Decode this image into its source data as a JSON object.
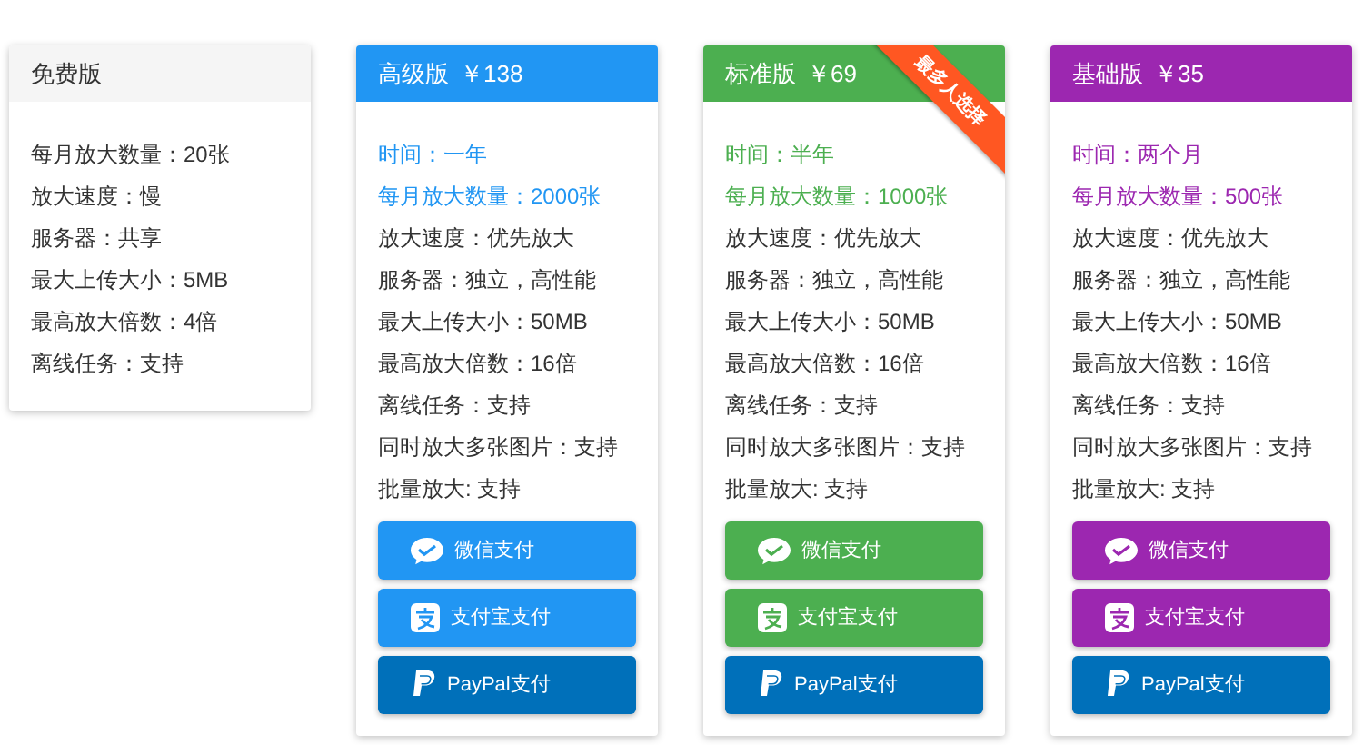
{
  "plans": [
    {
      "name": "免费版",
      "features": [
        {
          "text": "每月放大数量：20张"
        },
        {
          "text": "放大速度：慢"
        },
        {
          "text": "服务器：共享"
        },
        {
          "text": "最大上传大小：5MB"
        },
        {
          "text": "最高放大倍数：4倍"
        },
        {
          "text": "离线任务：支持"
        }
      ]
    },
    {
      "name": "高级版",
      "price": "￥138",
      "color": "#2196f3",
      "features": [
        {
          "text": "时间：一年",
          "highlight": true
        },
        {
          "text": "每月放大数量：2000张",
          "highlight": true
        },
        {
          "text": "放大速度：优先放大",
          "highlight": false
        },
        {
          "text": "服务器：独立，高性能",
          "highlight": false
        },
        {
          "text": "最大上传大小：50MB",
          "highlight": false
        },
        {
          "text": "最高放大倍数：16倍",
          "highlight": false
        },
        {
          "text": "离线任务：支持",
          "highlight": false
        },
        {
          "text": "同时放大多张图片：支持",
          "highlight": false
        },
        {
          "text": "批量放大: 支持",
          "highlight": false
        }
      ],
      "payments": [
        {
          "label": "微信支付",
          "kind": "wechat"
        },
        {
          "label": "支付宝支付",
          "kind": "alipay"
        },
        {
          "label": "PayPal支付",
          "kind": "paypal"
        }
      ]
    },
    {
      "name": "标准版",
      "price": "￥69",
      "color": "#4caf50",
      "ribbon": "最多人选择",
      "features": [
        {
          "text": "时间：半年",
          "highlight": true
        },
        {
          "text": "每月放大数量：1000张",
          "highlight": true
        },
        {
          "text": "放大速度：优先放大",
          "highlight": false
        },
        {
          "text": "服务器：独立，高性能",
          "highlight": false
        },
        {
          "text": "最大上传大小：50MB",
          "highlight": false
        },
        {
          "text": "最高放大倍数：16倍",
          "highlight": false
        },
        {
          "text": "离线任务：支持",
          "highlight": false
        },
        {
          "text": "同时放大多张图片：支持",
          "highlight": false
        },
        {
          "text": "批量放大: 支持",
          "highlight": false
        }
      ],
      "payments": [
        {
          "label": "微信支付",
          "kind": "wechat"
        },
        {
          "label": "支付宝支付",
          "kind": "alipay"
        },
        {
          "label": "PayPal支付",
          "kind": "paypal"
        }
      ]
    },
    {
      "name": "基础版",
      "price": "￥35",
      "color": "#9c27b0",
      "features": [
        {
          "text": "时间：两个月",
          "highlight": true
        },
        {
          "text": "每月放大数量：500张",
          "highlight": true
        },
        {
          "text": "放大速度：优先放大",
          "highlight": false
        },
        {
          "text": "服务器：独立，高性能",
          "highlight": false
        },
        {
          "text": "最大上传大小：50MB",
          "highlight": false
        },
        {
          "text": "最高放大倍数：16倍",
          "highlight": false
        },
        {
          "text": "离线任务：支持",
          "highlight": false
        },
        {
          "text": "同时放大多张图片：支持",
          "highlight": false
        },
        {
          "text": "批量放大: 支持",
          "highlight": false
        }
      ],
      "payments": [
        {
          "label": "微信支付",
          "kind": "wechat"
        },
        {
          "label": "支付宝支付",
          "kind": "alipay"
        },
        {
          "label": "PayPal支付",
          "kind": "paypal"
        }
      ]
    }
  ]
}
